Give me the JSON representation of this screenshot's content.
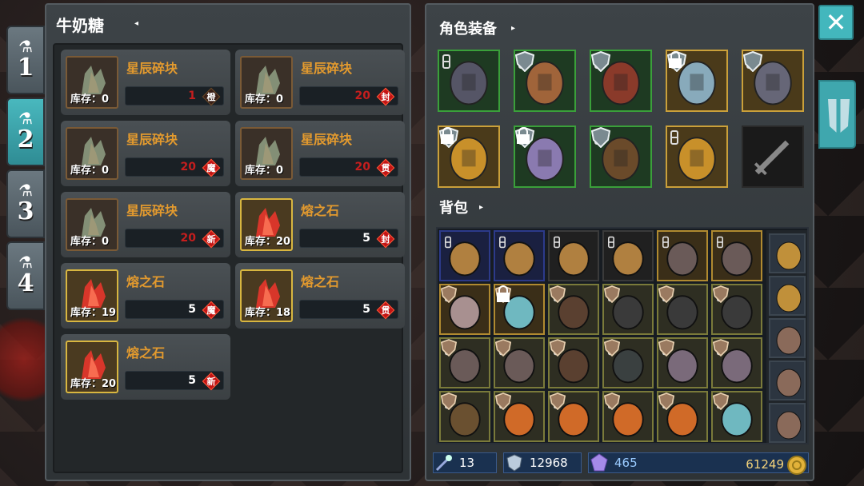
{
  "side_tabs": [
    {
      "num": "1",
      "active": false
    },
    {
      "num": "2",
      "active": true
    },
    {
      "num": "3",
      "active": false
    },
    {
      "num": "4",
      "active": false
    }
  ],
  "left_panel": {
    "title": "牛奶糖",
    "materials": [
      {
        "name": "星辰碎块",
        "stock": "库存：0",
        "count": "1",
        "seal": "橙"
      },
      {
        "name": "星辰碎块",
        "stock": "库存：0",
        "count": "20",
        "seal": "封"
      },
      {
        "name": "星辰碎块",
        "stock": "库存：0",
        "count": "20",
        "seal": "魔"
      },
      {
        "name": "星辰碎块",
        "stock": "库存：0",
        "count": "20",
        "seal": "贯"
      },
      {
        "name": "星辰碎块",
        "stock": "库存：0",
        "count": "20",
        "seal": "新"
      },
      {
        "name": "熔之石",
        "stock": "库存：20",
        "count": "5",
        "seal": "封"
      },
      {
        "name": "熔之石",
        "stock": "库存：19",
        "count": "5",
        "seal": "魔"
      },
      {
        "name": "熔之石",
        "stock": "库存：18",
        "count": "5",
        "seal": "贯"
      },
      {
        "name": "熔之石",
        "stock": "库存：20",
        "count": "5",
        "seal": "新"
      }
    ]
  },
  "right_panel": {
    "equipment_title": "角色装备",
    "equipment": [
      {
        "icon": "helmet-icon"
      },
      {
        "icon": "chest-armor-icon"
      },
      {
        "icon": "robe-armor-icon"
      },
      {
        "icon": "ring-icon"
      },
      {
        "icon": "dagger-icon"
      },
      {
        "icon": "amulet-icon"
      },
      {
        "icon": "gauntlet-icon"
      },
      {
        "icon": "boots-icon"
      },
      {
        "icon": "gold-ring-icon"
      },
      {
        "icon": "empty-weapon-icon"
      }
    ],
    "bag_title": "背包",
    "bag_items": [
      "backpack-icon",
      "backpack-icon",
      "backpack-icon",
      "backpack-icon",
      "helm-icon",
      "helm-icon",
      "mask-icon",
      "ring-icon",
      "boots-icon",
      "armor-icon",
      "armor-icon",
      "armor-icon",
      "helm-icon",
      "helm-icon",
      "boots-icon",
      "gauntlet-icon",
      "axe-icon",
      "axe-icon",
      "bow-icon",
      "amulet-icon",
      "amulet-icon",
      "amulet-icon",
      "amulet-icon",
      "ring-icon"
    ],
    "bag_side": [
      "backpack-icon",
      "backpack-icon",
      "helm-icon",
      "helm-icon",
      "helm-icon"
    ],
    "stats": {
      "wand": "13",
      "shield": "12968",
      "gems": "465",
      "gold": "61249"
    }
  },
  "colors": {
    "accent_teal": "#43b7bd",
    "material_name": "#e39a2e",
    "count_red": "#c51e1e"
  },
  "buttons": {
    "close": "✕"
  }
}
